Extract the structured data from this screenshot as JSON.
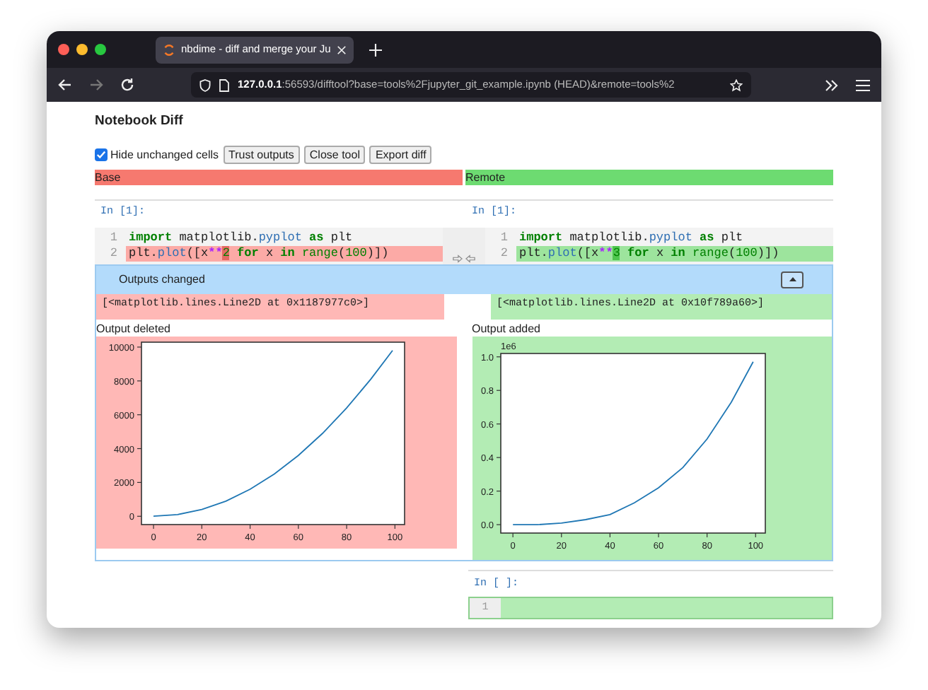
{
  "browser": {
    "tab_title": "nbdime - diff and merge your Ju",
    "url_host": "127.0.0.1",
    "url_rest": ":56593/difftool?base=tools%2Fjupyter_git_example.ipynb (HEAD)&remote=tools%2"
  },
  "page": {
    "title": "Notebook Diff"
  },
  "toolbar": {
    "hide_unchanged": {
      "label": "Hide unchanged cells",
      "checked": true
    },
    "buttons": [
      "Trust outputs",
      "Close tool",
      "Export diff"
    ]
  },
  "headers": [
    {
      "label": "Base",
      "kind": "base"
    },
    {
      "label": "Remote",
      "kind": "remote"
    }
  ],
  "cell": {
    "sides": [
      {
        "kind": "base",
        "prompt": "In [1]:",
        "lines": [
          {
            "number": "1",
            "changed": false,
            "tokens": [
              {
                "text": "import",
                "kind": "keyword"
              },
              {
                "text": " matplotlib.",
                "kind": "plain"
              },
              {
                "text": "pyplot",
                "kind": "attr"
              },
              {
                "text": " as",
                "kind": "keyword"
              },
              {
                "text": " plt",
                "kind": "plain"
              }
            ]
          },
          {
            "number": "2",
            "changed": true,
            "tokens": [
              {
                "text": "plt.",
                "kind": "plain"
              },
              {
                "text": "plot",
                "kind": "attr"
              },
              {
                "text": "([x",
                "kind": "plain"
              },
              {
                "text": "**",
                "kind": "operator"
              },
              {
                "text": "2",
                "kind": "changed"
              },
              {
                "text": " for",
                "kind": "keyword"
              },
              {
                "text": " x ",
                "kind": "plain"
              },
              {
                "text": "in",
                "kind": "keyword"
              },
              {
                "text": " range",
                "kind": "builtin"
              },
              {
                "text": "(",
                "kind": "plain"
              },
              {
                "text": "100",
                "kind": "number"
              },
              {
                "text": ")])",
                "kind": "plain"
              }
            ]
          }
        ]
      },
      {
        "kind": "remote",
        "prompt": "In [1]:",
        "lines": [
          {
            "number": "1",
            "changed": false,
            "tokens": [
              {
                "text": "import",
                "kind": "keyword"
              },
              {
                "text": " matplotlib.",
                "kind": "plain"
              },
              {
                "text": "pyplot",
                "kind": "attr"
              },
              {
                "text": " as",
                "kind": "keyword"
              },
              {
                "text": " plt",
                "kind": "plain"
              }
            ]
          },
          {
            "number": "2",
            "changed": true,
            "tokens": [
              {
                "text": "plt.",
                "kind": "plain"
              },
              {
                "text": "plot",
                "kind": "attr"
              },
              {
                "text": "([x",
                "kind": "plain"
              },
              {
                "text": "**",
                "kind": "operator"
              },
              {
                "text": "3",
                "kind": "changed"
              },
              {
                "text": " for",
                "kind": "keyword"
              },
              {
                "text": " x ",
                "kind": "plain"
              },
              {
                "text": "in",
                "kind": "keyword"
              },
              {
                "text": " range",
                "kind": "builtin"
              },
              {
                "text": "(",
                "kind": "plain"
              },
              {
                "text": "100",
                "kind": "number"
              },
              {
                "text": ")])",
                "kind": "plain"
              }
            ]
          }
        ]
      }
    ]
  },
  "outputs": {
    "title": "Outputs changed",
    "collapsed": false,
    "texts": [
      {
        "kind": "base",
        "text": "[<matplotlib.lines.Line2D at 0x1187977c0>]"
      },
      {
        "kind": "remote",
        "text": "[<matplotlib.lines.Line2D at 0x10f789a60>]"
      }
    ],
    "plots": [
      {
        "kind": "base",
        "label": "Output deleted",
        "chart_data": {
          "type": "line",
          "x": [
            0,
            10,
            20,
            30,
            40,
            50,
            60,
            70,
            80,
            90,
            99
          ],
          "series": [
            {
              "color": "#1f77b4",
              "values": [
                0,
                100,
                400,
                900,
                1600,
                2500,
                3600,
                4900,
                6400,
                8100,
                9800
              ]
            }
          ],
          "xlim": [
            -5,
            104
          ],
          "ylim": [
            -490,
            10290
          ],
          "xticks": [
            0,
            20,
            40,
            60,
            80,
            100
          ],
          "yticks": [
            0,
            2000,
            4000,
            6000,
            8000,
            10000
          ]
        }
      },
      {
        "kind": "remote",
        "label": "Output added",
        "chart_data": {
          "type": "line",
          "x": [
            0,
            10,
            20,
            30,
            40,
            50,
            60,
            70,
            80,
            90,
            99
          ],
          "series": [
            {
              "color": "#1f77b4",
              "values": [
                0,
                0,
                0.01,
                0.03,
                0.06,
                0.13,
                0.22,
                0.34,
                0.51,
                0.73,
                0.97
              ]
            }
          ],
          "xlim": [
            -5,
            104
          ],
          "ylim": [
            -0.05,
            1.02
          ],
          "xticks": [
            0,
            20,
            40,
            60,
            80,
            100
          ],
          "yticks": [
            {
              "value": 0,
              "label": "0.0"
            },
            {
              "value": 0.2,
              "label": "0.2"
            },
            {
              "value": 0.4,
              "label": "0.4"
            },
            {
              "value": 0.6,
              "label": "0.6"
            },
            {
              "value": 0.8,
              "label": "0.8"
            },
            {
              "value": 1,
              "label": "1.0"
            }
          ],
          "annotations": [
            "1e6"
          ]
        }
      }
    ]
  },
  "new_cell": {
    "prompt": "In [ ]:",
    "line_number": "1",
    "added": true
  }
}
